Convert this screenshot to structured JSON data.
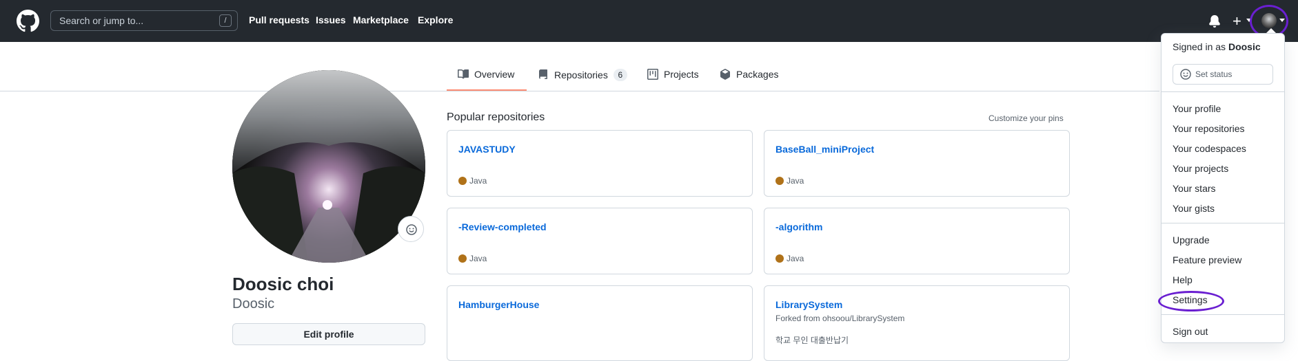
{
  "header": {
    "logo": "github-logo-icon",
    "search_placeholder": "Search or jump to...",
    "search_shortcut": "/",
    "nav": [
      "Pull requests",
      "Issues",
      "Marketplace",
      "Explore"
    ],
    "icons": [
      "bell-icon",
      "plus-icon",
      "avatar"
    ]
  },
  "tabs": [
    {
      "label": "Overview",
      "icon": "book-icon"
    },
    {
      "label": "Repositories",
      "icon": "repo-icon",
      "count": "6"
    },
    {
      "label": "Projects",
      "icon": "project-icon"
    },
    {
      "label": "Packages",
      "icon": "package-icon"
    }
  ],
  "profile": {
    "name": "Doosic choi",
    "login": "Doosic",
    "edit_button": "Edit profile"
  },
  "popular": {
    "title": "Popular repositories",
    "customize": "Customize your pins",
    "repos": [
      {
        "name": "JAVASTUDY",
        "language": "Java"
      },
      {
        "name": "BaseBall_miniProject",
        "language": "Java"
      },
      {
        "name": "-Review-completed",
        "language": "Java"
      },
      {
        "name": "-algorithm",
        "language": "Java"
      },
      {
        "name": "HamburgerHouse",
        "language": ""
      },
      {
        "name": "LibrarySystem",
        "forked": "Forked from ohsoou/LibrarySystem",
        "description": "학교 무인 대출반납기"
      }
    ],
    "language_color": "#b07219"
  },
  "dropdown": {
    "signed_in_prefix": "Signed in as",
    "signed_in_user": "Doosic",
    "set_status": "Set status",
    "group1": [
      "Your profile",
      "Your repositories",
      "Your codespaces",
      "Your projects",
      "Your stars",
      "Your gists"
    ],
    "group2": [
      "Upgrade",
      "Feature preview",
      "Help",
      "Settings"
    ],
    "sign_out": "Sign out"
  },
  "colors": {
    "header_bg": "#24292f",
    "link": "#0969da",
    "tab_underline": "#fd8c73",
    "annotation": "#6a1fd1"
  }
}
